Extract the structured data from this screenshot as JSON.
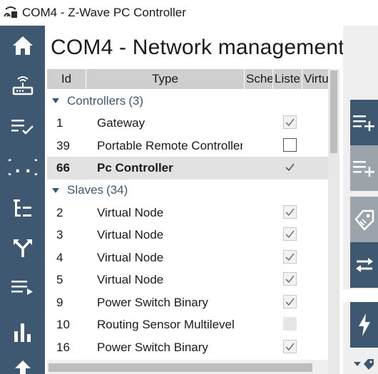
{
  "window": {
    "title": "COM4 - Z-Wave PC Controller"
  },
  "page": {
    "title": "COM4 - Network management"
  },
  "nav": {
    "items": [
      {
        "icon": "home-icon"
      },
      {
        "icon": "router-icon"
      },
      {
        "icon": "checklist-icon"
      },
      {
        "icon": "braces-icon"
      },
      {
        "icon": "tree-icon"
      },
      {
        "icon": "routing-icon"
      },
      {
        "icon": "playlist-icon"
      },
      {
        "icon": "bar-chart-icon"
      },
      {
        "icon": "upload-icon"
      }
    ]
  },
  "grid": {
    "columns": {
      "id": "Id",
      "type": "Type",
      "sche": "Sche",
      "liste": "Liste",
      "virtu": "Virtu"
    },
    "groups": [
      {
        "name": "Controllers",
        "count": "(3)",
        "rows": [
          {
            "id": "1",
            "type": "Gateway",
            "listening": "checked",
            "selected": false
          },
          {
            "id": "39",
            "type": "Portable Remote Controller",
            "listening": "unchecked",
            "selected": false
          },
          {
            "id": "66",
            "type": "Pc Controller",
            "listening": "checked",
            "selected": true
          }
        ]
      },
      {
        "name": "Slaves",
        "count": "(34)",
        "rows": [
          {
            "id": "2",
            "type": "Virtual Node",
            "listening": "checked",
            "selected": false
          },
          {
            "id": "3",
            "type": "Virtual Node",
            "listening": "checked",
            "selected": false
          },
          {
            "id": "4",
            "type": "Virtual Node",
            "listening": "checked",
            "selected": false
          },
          {
            "id": "5",
            "type": "Virtual Node",
            "listening": "checked",
            "selected": false
          },
          {
            "id": "9",
            "type": "Power Switch Binary",
            "listening": "checked",
            "selected": false
          },
          {
            "id": "10",
            "type": "Routing Sensor Multilevel",
            "listening": "disabled",
            "selected": false
          },
          {
            "id": "16",
            "type": "Power Switch Binary",
            "listening": "checked",
            "selected": false
          }
        ]
      }
    ]
  },
  "actions": {
    "items": [
      {
        "icon": "add-node-icon",
        "enabled": true
      },
      {
        "icon": "add-node-icon-disabled",
        "enabled": false
      },
      {
        "icon": "tag-icon",
        "enabled": false
      },
      {
        "icon": "swap-arrows-icon",
        "enabled": true
      },
      {
        "icon": "lightning-icon",
        "enabled": true
      }
    ],
    "footer_icons": [
      "chevron-down-icon",
      "tag-small-icon"
    ]
  },
  "colors": {
    "nav_bg": "#3d5870",
    "accent": "#3d5870",
    "disabled_action": "#9ba3ab",
    "header_bg": "#cfcfcf",
    "selected_row": "#e2e2e2"
  }
}
